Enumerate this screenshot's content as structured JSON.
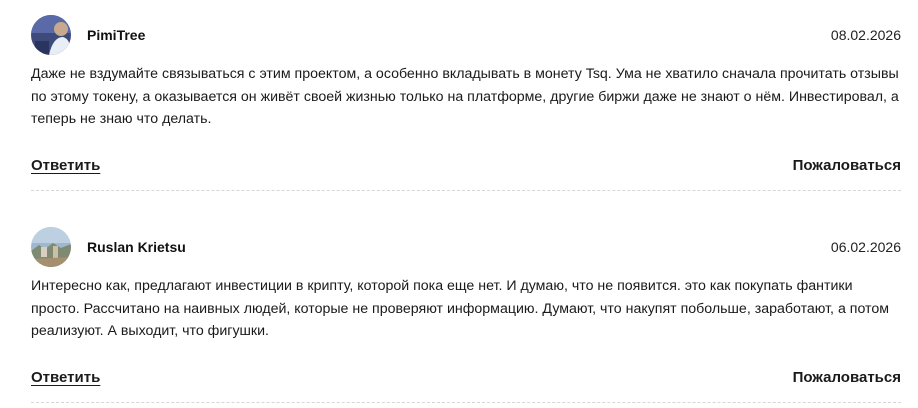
{
  "comments": [
    {
      "author": "PimiTree",
      "date": "08.02.2026",
      "avatar": "avatar-photo-person",
      "text": "Даже не вздумайте связываться с этим проектом, а особенно вкладывать в монету Tsq. Ума не хватило сначала прочитать отзывы по этому токену, а оказывается он живёт своей жизнью только на платформе, другие биржи даже не знают о нём. Инвестировал, а теперь не знаю что делать.",
      "reply_label": "Ответить",
      "report_label": "Пожаловаться"
    },
    {
      "author": "Ruslan Krietsu",
      "date": "06.02.2026",
      "avatar": "avatar-photo-landscape",
      "text": "Интересно как, предлагают инвестиции в крипту, которой пока еще нет. И думаю, что не появится. это как покупать фантики просто. Рассчитано на наивных людей, которые не проверяют информацию. Думают, что накупят побольше, заработают, а потом реализуют. А выходит, что фигушки.",
      "reply_label": "Ответить",
      "report_label": "Пожаловаться"
    }
  ]
}
